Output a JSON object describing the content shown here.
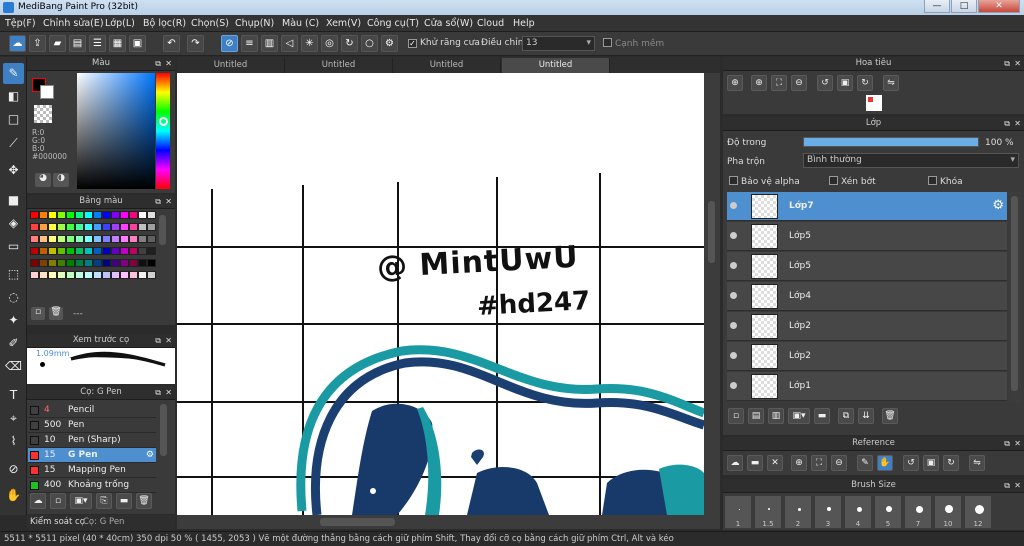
{
  "window": {
    "title": "MediBang Paint Pro (32bit)",
    "minimize": "—",
    "maximize": "□",
    "close": "✕"
  },
  "menu": [
    "Tệp(F)",
    "Chỉnh sửa(E)",
    "Lớp(L)",
    "Bộ lọc(R)",
    "Chọn(S)",
    "Chụp(N)",
    "Màu (C)",
    "Xem(V)",
    "Công cụ(T)",
    "Cửa sổ(W)",
    "Cloud",
    "Help"
  ],
  "toolbar": {
    "antialias_label": "Khử răng cưa",
    "adjust_label": "Điều chỉnh",
    "adjust_value": "13",
    "edge_label": "Cạnh mềm"
  },
  "color_panel": {
    "title": "Màu",
    "r": "R:0",
    "g": "G:0",
    "b": "B:0",
    "hex": "#000000"
  },
  "palette_panel": {
    "title": "Bảng màu",
    "more": "---",
    "colors": [
      "#ff0000",
      "#ff8000",
      "#ffff00",
      "#80ff00",
      "#00ff00",
      "#00ff80",
      "#00ffff",
      "#0080ff",
      "#0000ff",
      "#8000ff",
      "#ff00ff",
      "#ff0080",
      "#ffffff",
      "#e0e0e0",
      "#ff4040",
      "#ffa040",
      "#ffff40",
      "#a0ff40",
      "#40ff40",
      "#40ffa0",
      "#40ffff",
      "#40a0ff",
      "#4040ff",
      "#a040ff",
      "#ff40ff",
      "#ff40a0",
      "#c0c0c0",
      "#a0a0a0",
      "#ff8080",
      "#ffc080",
      "#ffff80",
      "#c0ff80",
      "#80ff80",
      "#80ffc0",
      "#80ffff",
      "#80c0ff",
      "#8080ff",
      "#c080ff",
      "#ff80ff",
      "#ff80c0",
      "#808080",
      "#606060",
      "#c00000",
      "#c06000",
      "#c0c000",
      "#60c000",
      "#00c000",
      "#00c060",
      "#00c0c0",
      "#0060c0",
      "#0000c0",
      "#6000c0",
      "#c000c0",
      "#c00060",
      "#404040",
      "#202020",
      "#800000",
      "#804000",
      "#808000",
      "#408000",
      "#008000",
      "#008040",
      "#008080",
      "#004080",
      "#000080",
      "#400080",
      "#800080",
      "#800040",
      "#101010",
      "#000000",
      "#ffd0d0",
      "#ffe0c0",
      "#ffffc0",
      "#e0ffc0",
      "#c0ffc0",
      "#c0ffe0",
      "#c0ffff",
      "#c0e0ff",
      "#c0c0ff",
      "#e0c0ff",
      "#ffc0ff",
      "#ffc0e0",
      "#f0f0f0",
      "#d0d0d0"
    ]
  },
  "preview_panel": {
    "title": "Xem trước cọ",
    "size": "1.09mm"
  },
  "brush_panel": {
    "title": "Cọ: G Pen",
    "items": [
      {
        "size": "4",
        "name": "Pencil",
        "color": "#404040"
      },
      {
        "size": "500",
        "name": "Pen",
        "color": "#404040"
      },
      {
        "size": "10",
        "name": "Pen (Sharp)",
        "color": "#404040"
      },
      {
        "size": "15",
        "name": "G Pen",
        "color": "#ff3030"
      },
      {
        "size": "15",
        "name": "Mapping Pen",
        "color": "#ff3030"
      },
      {
        "size": "400",
        "name": "Khoảng trống [Edge",
        "color": "#20c020"
      }
    ]
  },
  "left_tabs": {
    "control": "Kiểm soát cọ",
    "brush": "Cọ: G Pen"
  },
  "canvas": {
    "tabs": [
      "Untitled",
      "Untitled",
      "Untitled",
      "Untitled"
    ],
    "handwriting_1": "@ MintUwU",
    "handwriting_2": "#hd247"
  },
  "navigator_panel": {
    "title": "Hoa tiêu"
  },
  "layer_panel": {
    "title": "Lớp",
    "opacity_label": "Độ trong",
    "opacity_value": "100 %",
    "opacity": 1.0,
    "blend_label": "Pha trộn",
    "blend_value": "Bình thường",
    "protect_alpha": "Bảo vệ alpha",
    "clipping": "Xén bớt",
    "lock": "Khóa",
    "layers": [
      "Lớp7",
      "Lớp5",
      "Lớp5",
      "Lớp4",
      "Lớp2",
      "Lớp2",
      "Lớp1"
    ]
  },
  "reference_panel": {
    "title": "Reference"
  },
  "brushsize_panel": {
    "title": "Brush Size",
    "sizes": [
      "1",
      "1.5",
      "2",
      "3",
      "4",
      "5",
      "7",
      "10",
      "12"
    ]
  },
  "status": "5511 * 5511 pixel  (40 * 40cm)  350 dpi  50 %  ( 1455, 2053 )  Vẽ một đường thẳng bằng cách giữ phím Shift, Thay đổi cỡ cọ bằng cách giữ phím Ctrl, Alt và kéo"
}
